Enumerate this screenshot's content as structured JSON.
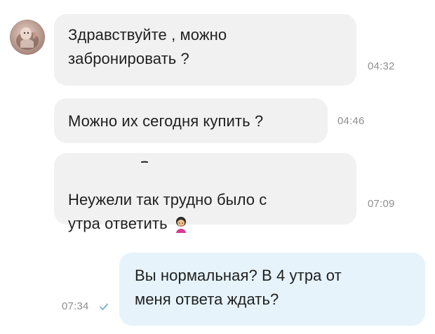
{
  "chat": {
    "messages": [
      {
        "text": "Здравствуйте , можно\nзабронировать ?",
        "time": "04:32"
      },
      {
        "text": "Можно их сегодня купить ?",
        "time": "04:46"
      },
      {
        "text": "Неужели так трудно было с\nутра ответить",
        "time": "07:09",
        "emoji": "woman-emoji-icon"
      },
      {
        "text": "Вы нормальная? В 4 утра от\nменя ответа ждать?",
        "time": "07:34",
        "status": "sent-check-icon"
      }
    ]
  },
  "theme": {
    "incoming_bubble": "#f1f1f1",
    "outgoing_bubble": "#e6f3fb",
    "time_color": "#8f8f8f",
    "check_color": "#7aaed4"
  },
  "icons": {
    "avatar": "avatar",
    "emoji": "woman-emoji-icon",
    "check": "check-icon"
  }
}
